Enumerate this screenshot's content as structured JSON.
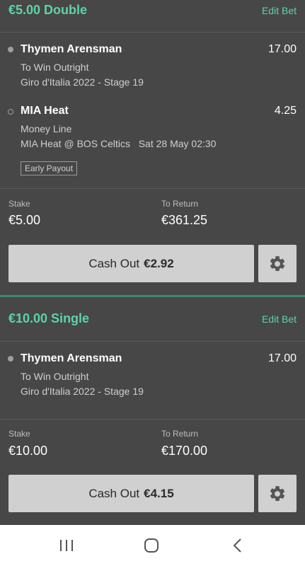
{
  "bets": [
    {
      "title": "€5.00 Double",
      "edit_label": "Edit Bet",
      "selections": [
        {
          "name": "Thymen Arensman",
          "odds": "17.00",
          "market": "To Win Outright",
          "event": "Giro d'Italia 2022 - Stage 19"
        },
        {
          "name": "MIA Heat",
          "odds": "4.25",
          "market": "Money Line",
          "event": "MIA Heat @ BOS Celtics   Sat 28 May 02:30",
          "badge": "Early Payout"
        }
      ],
      "stake_label": "Stake",
      "stake": "€5.00",
      "return_label": "To Return",
      "return": "€361.25",
      "cashout_label": "Cash Out",
      "cashout_amount": "€2.92"
    },
    {
      "title": "€10.00 Single",
      "edit_label": "Edit Bet",
      "selections": [
        {
          "name": "Thymen Arensman",
          "odds": "17.00",
          "market": "To Win Outright",
          "event": "Giro d'Italia 2022 - Stage 19"
        }
      ],
      "stake_label": "Stake",
      "stake": "€10.00",
      "return_label": "To Return",
      "return": "€170.00",
      "cashout_label": "Cash Out",
      "cashout_amount": "€4.15"
    }
  ],
  "nav": {
    "icons": [
      "recent-apps-icon",
      "home-icon",
      "back-icon"
    ]
  },
  "colors": {
    "background": "#474747",
    "accent": "#5ed3a6",
    "button": "#d0d0d0",
    "navbar": "#ffffff"
  }
}
